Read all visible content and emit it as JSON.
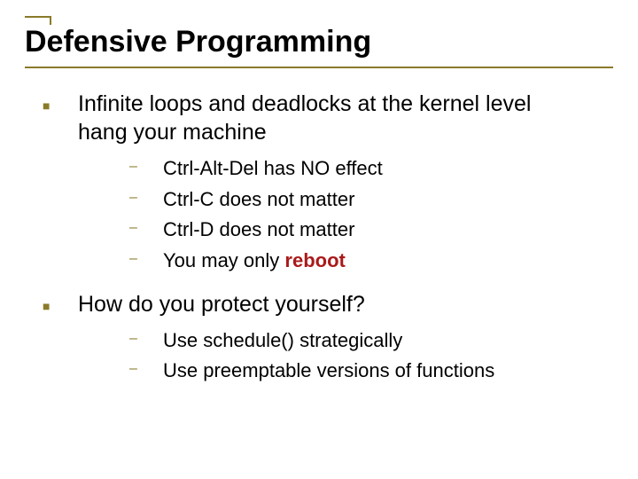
{
  "title": "Defensive Programming",
  "points": [
    {
      "text": "Infinite loops and deadlocks at the kernel level hang your machine",
      "sub": [
        {
          "text": "Ctrl-Alt-Del has NO effect"
        },
        {
          "text": "Ctrl-C does not matter"
        },
        {
          "text": "Ctrl-D does not matter"
        },
        {
          "text": "You may only ",
          "emph": "reboot"
        }
      ]
    },
    {
      "text": "How do you protect yourself?",
      "sub": [
        {
          "text": "Use schedule() strategically"
        },
        {
          "text": "Use preemptable versions of functions"
        }
      ]
    }
  ]
}
